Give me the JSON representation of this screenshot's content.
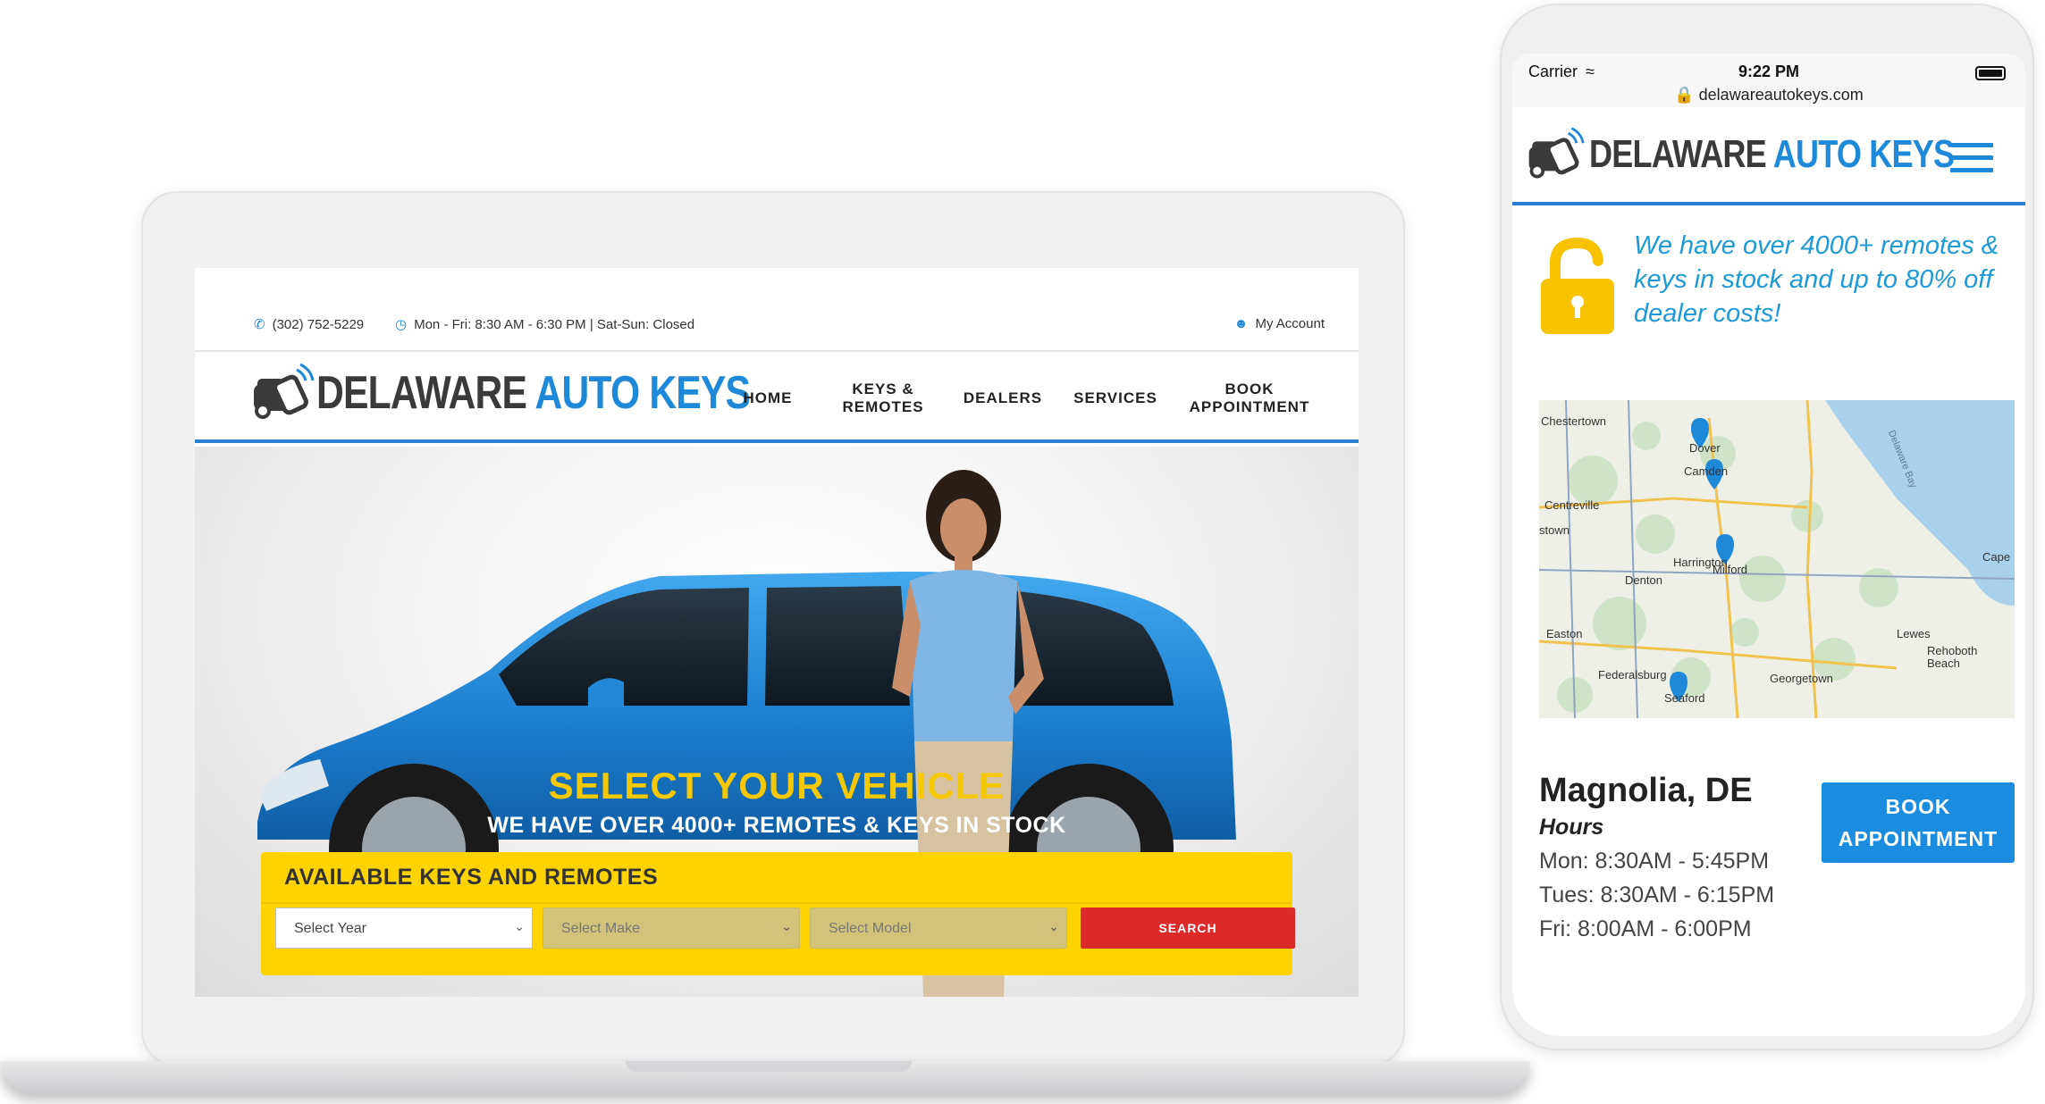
{
  "brand": {
    "name_dark": "DELAWARE",
    "name_blue": "AUTO KEYS",
    "blue": "#1e88d9",
    "yellow": "#ffd300",
    "red": "#dc2a2a"
  },
  "desktop": {
    "topbar": {
      "phone": "(302) 752-5229",
      "hours": "Mon - Fri: 8:30 AM - 6:30 PM | Sat-Sun: Closed",
      "account": "My Account"
    },
    "nav": [
      {
        "label": "HOME"
      },
      {
        "label": "KEYS &\nREMOTES"
      },
      {
        "label": "DEALERS"
      },
      {
        "label": "SERVICES"
      },
      {
        "label": "BOOK\nAPPOINTMENT"
      }
    ],
    "hero": {
      "title": "SELECT YOUR VEHICLE",
      "subtitle": "WE HAVE OVER 4000+ REMOTES & KEYS IN STOCK"
    },
    "search": {
      "title": "AVAILABLE KEYS AND REMOTES",
      "year": "Select Year",
      "make": "Select Make",
      "model": "Select Model",
      "button": "SEARCH"
    }
  },
  "mobile": {
    "status": {
      "carrier": "Carrier",
      "time": "9:22 PM",
      "url": "delawareautokeys.com"
    },
    "promo": "We have over 4000+ remotes & keys in stock and up to 80% off dealer costs!",
    "map_labels": [
      "Chestertown",
      "Dover",
      "Camden",
      "Centreville",
      "stown",
      "Harrington",
      "Milford",
      "Denton",
      "Cape",
      "Easton",
      "Lewes",
      "Rehoboth Beach",
      "Federalsburg",
      "Georgetown",
      "Seaford",
      "Delaware Bay"
    ],
    "location": {
      "title": "Magnolia, DE",
      "hours_heading": "Hours",
      "hours": [
        "Mon: 8:30AM - 5:45PM",
        "Tues: 8:30AM - 6:15PM",
        "Fri: 8:00AM - 6:00PM"
      ],
      "book_line1": "BOOK",
      "book_line2": "APPOINTMENT"
    }
  }
}
